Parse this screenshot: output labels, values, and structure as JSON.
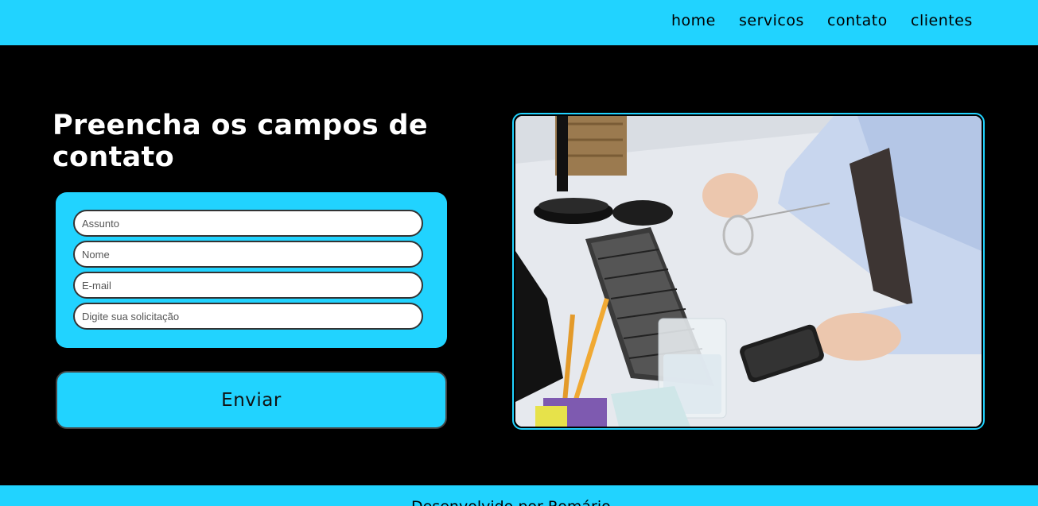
{
  "nav": {
    "items": [
      {
        "label": "home"
      },
      {
        "label": "servicos"
      },
      {
        "label": "contato"
      },
      {
        "label": "clientes"
      }
    ]
  },
  "main": {
    "title": "Preencha os campos de contato",
    "form": {
      "subject_placeholder": "Assunto",
      "name_placeholder": "Nome",
      "email_placeholder": "E-mail",
      "request_placeholder": "Digite sua solicitação",
      "submit_label": "Enviar"
    }
  },
  "footer": {
    "text": "Desenvolvido por Romário"
  },
  "colors": {
    "accent": "#21d3ff",
    "background": "#000000"
  }
}
